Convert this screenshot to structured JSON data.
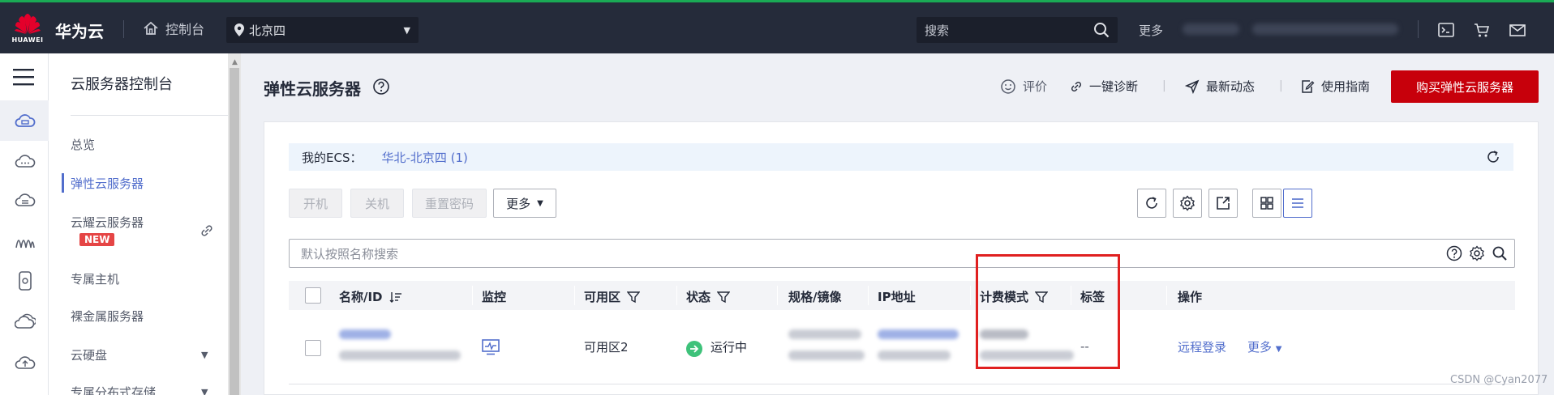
{
  "header": {
    "brand": "华为云",
    "logo_word": "HUAWEI",
    "console_label": "控制台",
    "region": "北京四",
    "search_placeholder": "搜索",
    "more_label": "更多"
  },
  "sidenav": {
    "title": "云服务器控制台",
    "items": [
      {
        "label": "总览"
      },
      {
        "label": "弹性云服务器"
      },
      {
        "label": "云耀云服务器"
      },
      {
        "label": "专属主机"
      },
      {
        "label": "裸金属服务器"
      },
      {
        "label": "云硬盘"
      },
      {
        "label": "专属分布式存储"
      }
    ],
    "new_badge": "NEW"
  },
  "page": {
    "title": "弹性云服务器",
    "links": {
      "rate": "评价",
      "diagnose": "一键诊断",
      "news": "最新动态",
      "guide": "使用指南"
    },
    "buy_button": "购买弹性云服务器"
  },
  "myecs": {
    "label": "我的ECS：",
    "link": "华北-北京四 (1)"
  },
  "toolbar": {
    "start": "开机",
    "stop": "关机",
    "reset_password": "重置密码",
    "more": "更多"
  },
  "filter": {
    "placeholder": "默认按照名称搜索"
  },
  "table": {
    "columns": [
      "名称/ID",
      "监控",
      "可用区",
      "状态",
      "规格/镜像",
      "IP地址",
      "计费模式",
      "标签",
      "操作"
    ],
    "rows": [
      {
        "zone": "可用区2",
        "status": "运行中",
        "tag": "--",
        "remote_login": "远程登录",
        "more": "更多"
      }
    ]
  },
  "watermark": "CSDN @Cyan2077",
  "colors": {
    "brand_red": "#c7000b",
    "link_blue": "#526ecc",
    "topbar": "#252b3a",
    "running_green": "#3ec27a",
    "highlight_red": "#e02020"
  }
}
